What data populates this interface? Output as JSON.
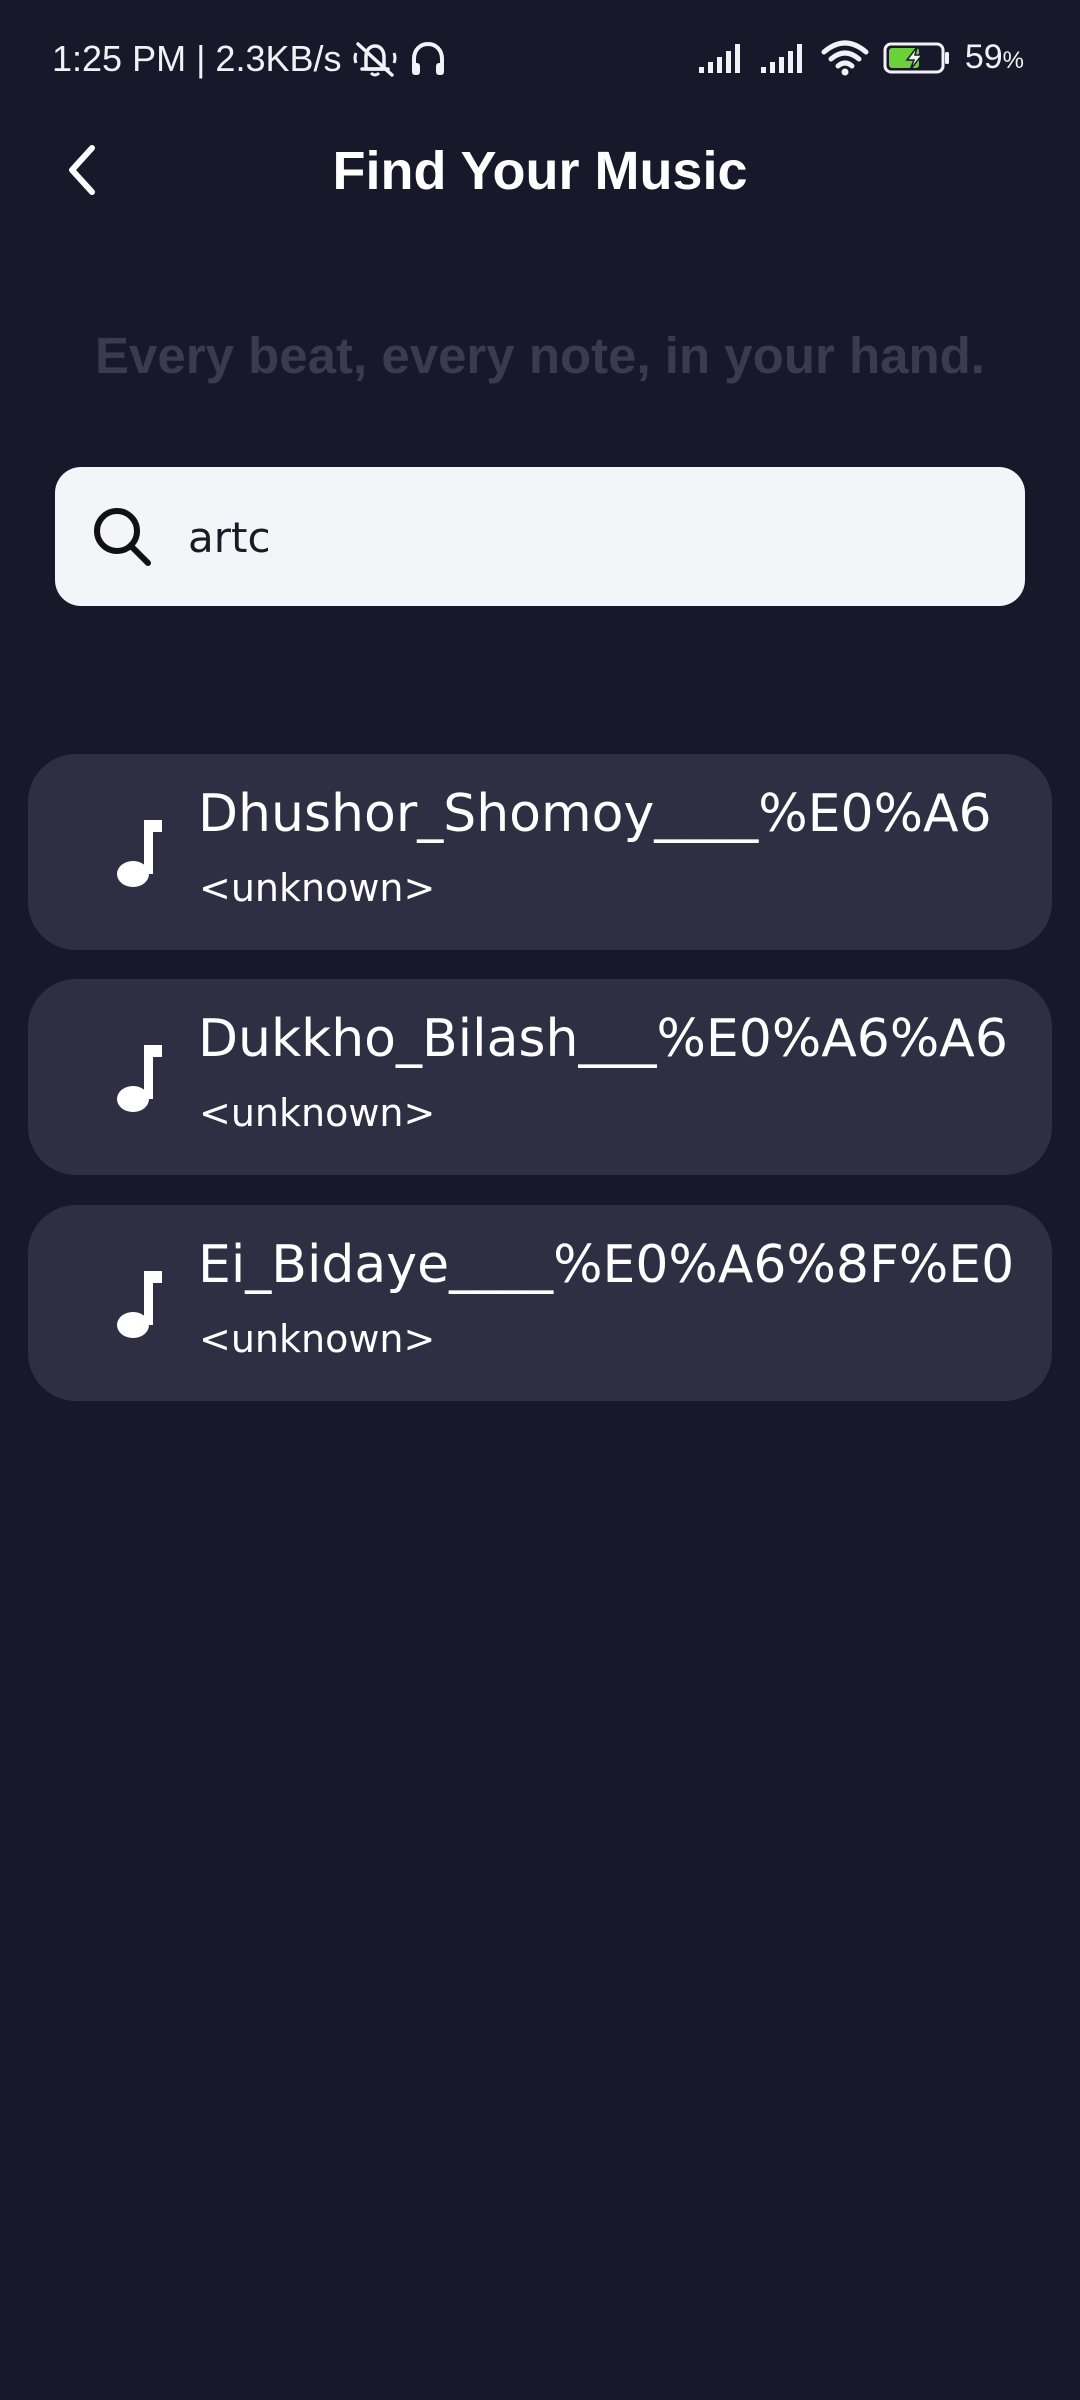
{
  "status_bar": {
    "time_speed": "1:25 PM | 2.3KB/s",
    "battery_percent": "59",
    "battery_suffix": "%",
    "icons": [
      "notifications-off-icon",
      "headphones-icon",
      "signal-icon",
      "signal-icon",
      "wifi-icon",
      "battery-charging-icon"
    ],
    "battery_accent": "#6bd13b"
  },
  "header": {
    "title": "Find Your Music",
    "back_icon": "chevron-left-icon"
  },
  "tagline": "Every beat, every note, in your hand.",
  "search": {
    "value": "artc",
    "icon": "search-icon"
  },
  "results": [
    {
      "title": "Dhushor_Shomoy____%E0%A6",
      "subtitle": "<unknown>",
      "icon": "music-note-icon"
    },
    {
      "title": "Dukkho_Bilash___%E0%A6%A6",
      "subtitle": "<unknown>",
      "icon": "music-note-icon"
    },
    {
      "title": "Ei_Bidaye____%E0%A6%8F%E0",
      "subtitle": "<unknown>",
      "icon": "music-note-icon"
    }
  ],
  "colors": {
    "background": "#17182a",
    "card": "#2e2f43",
    "search_bg": "#f4f5f9",
    "tagline": "#3a3b50"
  }
}
